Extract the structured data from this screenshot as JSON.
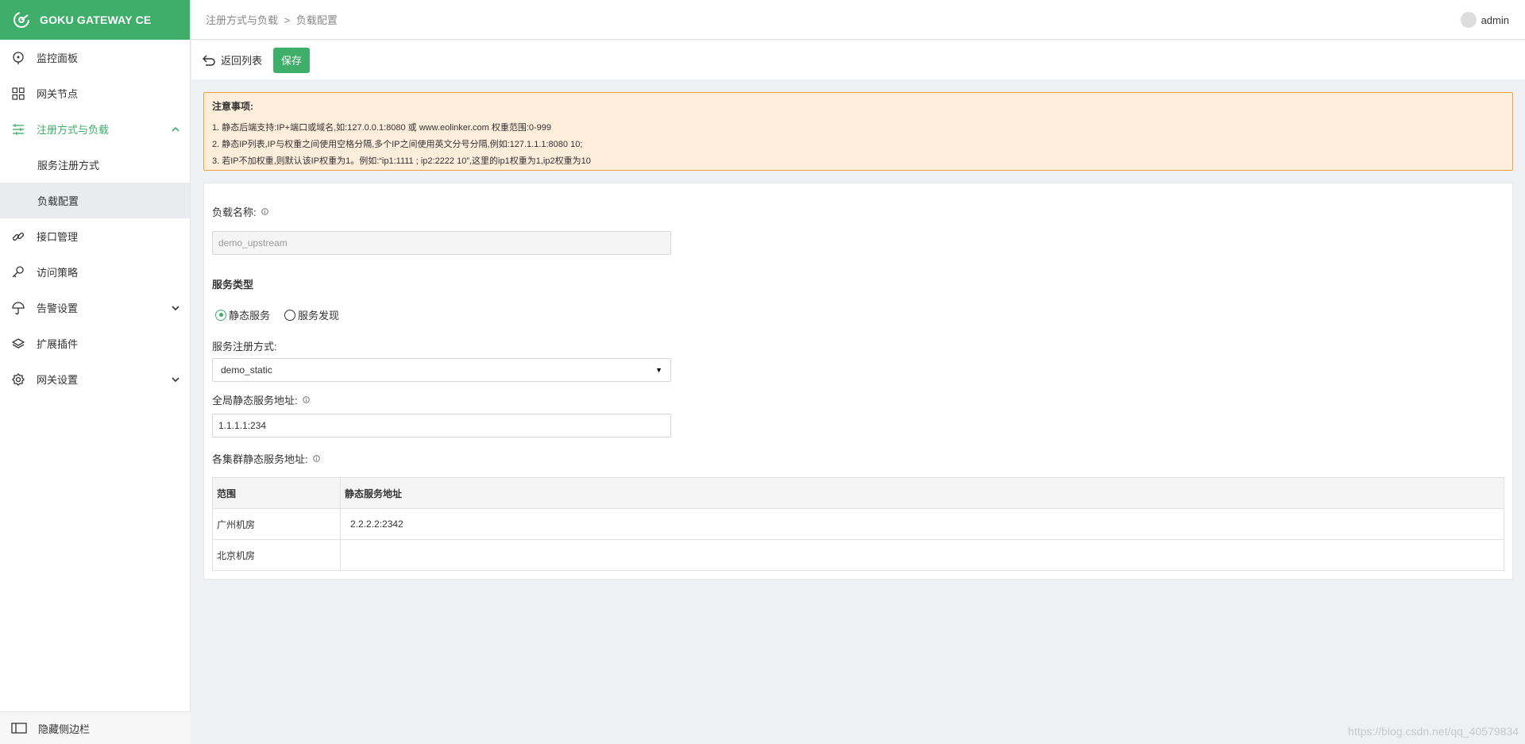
{
  "brand": {
    "title": "GOKU GATEWAY CE"
  },
  "colors": {
    "accent": "#3eae6a",
    "notice_bg": "#fdeedc",
    "notice_border": "#f0a13c"
  },
  "sidebar": {
    "items": [
      {
        "label": "监控面板",
        "icon": "dashboard-icon"
      },
      {
        "label": "网关节点",
        "icon": "grid-icon"
      },
      {
        "label": "注册方式与负载",
        "icon": "sliders-icon",
        "expanded": true,
        "children": [
          {
            "label": "服务注册方式"
          },
          {
            "label": "负载配置",
            "active": true
          }
        ]
      },
      {
        "label": "接口管理",
        "icon": "link-icon"
      },
      {
        "label": "访问策略",
        "icon": "key-icon"
      },
      {
        "label": "告警设置",
        "icon": "bell-icon",
        "expandable": true
      },
      {
        "label": "扩展插件",
        "icon": "layers-icon"
      },
      {
        "label": "网关设置",
        "icon": "gear-icon",
        "expandable": true
      }
    ],
    "footer_label": "隐藏侧边栏"
  },
  "header": {
    "breadcrumb": [
      "注册方式与负载",
      "负载配置"
    ],
    "breadcrumb_sep": ">",
    "user": "admin"
  },
  "toolbar": {
    "back_label": "返回列表",
    "save_label": "保存"
  },
  "notice": {
    "title": "注意事项:",
    "lines": [
      "1. 静态后端支持:IP+端口或域名,如:127.0.0.1:8080 或 www.eolinker.com 权重范围:0-999",
      "2. 静态IP列表,IP与权重之间使用空格分隔,多个IP之间使用英文分号分隔,例如:127.1.1.1:8080 10;",
      "3. 若IP不加权重,则默认该IP权重为1。例如:“ip1:1111 ; ip2:2222 10”,这里的ip1权重为1,ip2权重为10"
    ]
  },
  "form": {
    "name_label": "负载名称:",
    "name_value": "demo_upstream",
    "service_type_label": "服务类型",
    "radio_static": "静态服务",
    "radio_discovery": "服务发现",
    "selected_type": "static",
    "register_label": "服务注册方式:",
    "register_value": "demo_static",
    "global_addr_label": "全局静态服务地址:",
    "global_addr_value": "1.1.1.1:234",
    "cluster_label": "各集群静态服务地址:"
  },
  "cluster_table": {
    "headers": [
      "范围",
      "静态服务地址"
    ],
    "rows": [
      [
        "广州机房",
        "2.2.2.2:2342"
      ],
      [
        "北京机房",
        ""
      ]
    ]
  },
  "watermark": "https://blog.csdn.net/qq_40579834"
}
